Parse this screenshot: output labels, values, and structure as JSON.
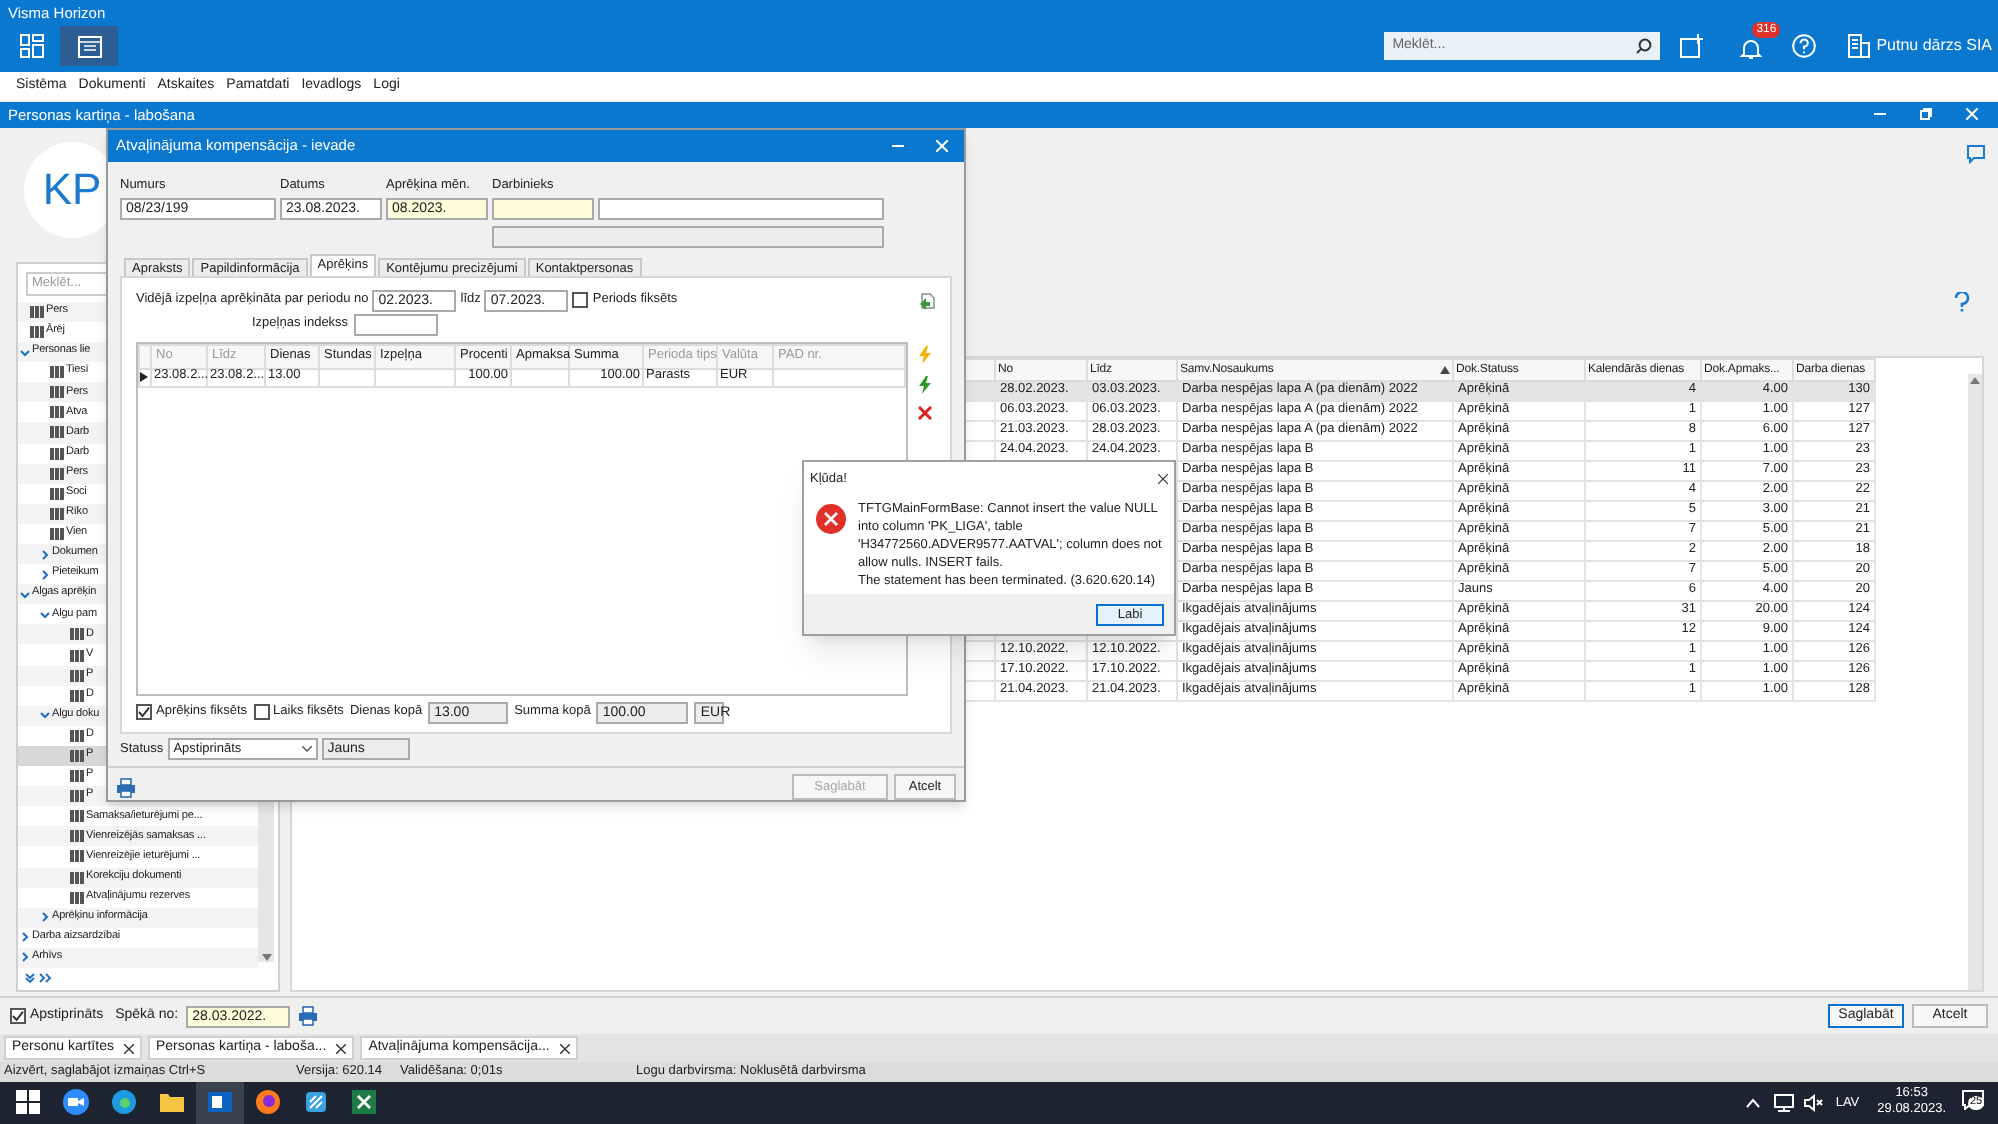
{
  "app": {
    "title": "Visma Horizon",
    "search": {
      "placeholder": "Meklēt..."
    },
    "notifications": "316",
    "company": "Putnu dārzs SIA",
    "menu": [
      "Sistēma",
      "Dokumenti",
      "Atskaites",
      "Pamatdati",
      "Ievadlogs",
      "Logi"
    ]
  },
  "window": {
    "title": "Personas kartiņa - labošana",
    "avatar": "KP",
    "sidebar": {
      "search": {
        "placeholder": "Meklēt..."
      },
      "tree": [
        {
          "label": "Pers",
          "kind": "doc",
          "selected": false
        },
        {
          "label": "Ārēj",
          "kind": "doc",
          "selected": false
        },
        {
          "label": "Personas lie",
          "kind": "folder",
          "expanded": true,
          "selected": false,
          "children": [
            {
              "label": "Tiesī",
              "kind": "doc",
              "selected": false
            },
            {
              "label": "Pers",
              "kind": "doc",
              "selected": false
            },
            {
              "label": "Atva",
              "kind": "doc",
              "selected": false
            },
            {
              "label": "Darb",
              "kind": "doc",
              "selected": false
            },
            {
              "label": "Darb",
              "kind": "doc",
              "selected": false
            },
            {
              "label": "Pers",
              "kind": "doc",
              "selected": false
            },
            {
              "label": "Soci",
              "kind": "doc",
              "selected": false
            },
            {
              "label": "Rīko",
              "kind": "doc",
              "selected": false
            },
            {
              "label": "Vien",
              "kind": "doc",
              "selected": false
            },
            {
              "label": "Dokumen",
              "kind": "folder",
              "expanded": false,
              "selected": false
            },
            {
              "label": "Pieteikum",
              "kind": "folder",
              "expanded": false,
              "selected": false
            }
          ]
        },
        {
          "label": "Algas aprēķin",
          "kind": "folder",
          "expanded": true,
          "selected": false,
          "children": [
            {
              "label": "Algu pam",
              "kind": "folder",
              "expanded": true,
              "selected": false,
              "children": [
                {
                  "label": "D",
                  "kind": "doc",
                  "selected": false
                },
                {
                  "label": "V",
                  "kind": "doc",
                  "selected": false
                },
                {
                  "label": "P",
                  "kind": "doc",
                  "selected": false
                },
                {
                  "label": "D",
                  "kind": "doc",
                  "selected": false
                }
              ]
            },
            {
              "label": "Algu doku",
              "kind": "folder",
              "expanded": true,
              "selected": false,
              "children": [
                {
                  "label": "D",
                  "kind": "doc",
                  "selected": false
                },
                {
                  "label": "P",
                  "kind": "doc",
                  "selected": true
                },
                {
                  "label": "P",
                  "kind": "doc",
                  "selected": false
                },
                {
                  "label": "P",
                  "kind": "doc",
                  "selected": false
                },
                {
                  "label": "Samaksa/ieturējumi pe...",
                  "kind": "doc",
                  "selected": false
                },
                {
                  "label": "Vienreizējās samaksas ...",
                  "kind": "doc",
                  "selected": false
                },
                {
                  "label": "Vienreizējie ieturējumi ...",
                  "kind": "doc",
                  "selected": false
                },
                {
                  "label": "Korekciju dokumenti",
                  "kind": "doc",
                  "selected": false
                },
                {
                  "label": "Atvaļinājumu rezerves",
                  "kind": "doc",
                  "selected": false
                }
              ]
            },
            {
              "label": "Aprēķinu informācija",
              "kind": "folder",
              "expanded": false,
              "selected": false
            }
          ]
        },
        {
          "label": "Darba aizsardzībai",
          "kind": "folder",
          "expanded": false,
          "selected": false
        },
        {
          "label": "Arhīvs",
          "kind": "folder",
          "expanded": false,
          "selected": false
        }
      ]
    },
    "table": {
      "columns": [
        {
          "label": "No",
          "sorted": false
        },
        {
          "label": "Līdz",
          "sorted": false
        },
        {
          "label": "Samv.Nosaukums",
          "sorted": true
        },
        {
          "label": "Dok.Statuss",
          "sorted": false
        },
        {
          "label": "Kalendārās dienas",
          "sorted": false
        },
        {
          "label": "Dok.Apmaks...",
          "sorted": false
        },
        {
          "label": "Darba dienas",
          "sorted": false
        }
      ],
      "rows": [
        {
          "selected": true,
          "cells": [
            "28.02.2023.",
            "03.03.2023.",
            "Darba nespējas lapa A (pa dienām) 2022",
            "Aprēķinā",
            "4",
            "4.00",
            "130"
          ]
        },
        {
          "selected": false,
          "cells": [
            "06.03.2023.",
            "06.03.2023.",
            "Darba nespējas lapa A (pa dienām) 2022",
            "Aprēķinā",
            "1",
            "1.00",
            "127"
          ]
        },
        {
          "selected": false,
          "cells": [
            "21.03.2023.",
            "28.03.2023.",
            "Darba nespējas lapa A (pa dienām) 2022",
            "Aprēķinā",
            "8",
            "6.00",
            "127"
          ]
        },
        {
          "selected": false,
          "cells": [
            "24.04.2023.",
            "24.04.2023.",
            "Darba nespējas lapa B",
            "Aprēķinā",
            "1",
            "1.00",
            "23"
          ]
        },
        {
          "selected": false,
          "cells": [
            null,
            null,
            "Darba nespējas lapa B",
            "Aprēķinā",
            "11",
            "7.00",
            "23"
          ]
        },
        {
          "selected": false,
          "cells": [
            null,
            null,
            "Darba nespējas lapa B",
            "Aprēķinā",
            "4",
            "2.00",
            "22"
          ]
        },
        {
          "selected": false,
          "cells": [
            null,
            null,
            "Darba nespējas lapa B",
            "Aprēķinā",
            "5",
            "3.00",
            "21"
          ]
        },
        {
          "selected": false,
          "cells": [
            null,
            null,
            "Darba nespējas lapa B",
            "Aprēķinā",
            "7",
            "5.00",
            "21"
          ]
        },
        {
          "selected": false,
          "cells": [
            null,
            null,
            "Darba nespējas lapa B",
            "Aprēķinā",
            "2",
            "2.00",
            "18"
          ]
        },
        {
          "selected": false,
          "cells": [
            null,
            null,
            "Darba nespējas lapa B",
            "Aprēķinā",
            "7",
            "5.00",
            "20"
          ]
        },
        {
          "selected": false,
          "cells": [
            null,
            null,
            "Darba nespējas lapa B",
            "Jauns",
            "6",
            "4.00",
            "20"
          ]
        },
        {
          "selected": false,
          "cells": [
            null,
            null,
            "Ikgadējais atvaļinājums",
            "Aprēķinā",
            "31",
            "20.00",
            "124"
          ]
        },
        {
          "selected": false,
          "cells": [
            null,
            null,
            "Ikgadējais atvaļinājums",
            "Aprēķinā",
            "12",
            "9.00",
            "124"
          ]
        },
        {
          "selected": false,
          "cells": [
            "12.10.2022.",
            "12.10.2022.",
            "Ikgadējais atvaļinājums",
            "Aprēķinā",
            "1",
            "1.00",
            "126"
          ]
        },
        {
          "selected": false,
          "cells": [
            "17.10.2022.",
            "17.10.2022.",
            "Ikgadējais atvaļinājums",
            "Aprēķinā",
            "1",
            "1.00",
            "126"
          ]
        },
        {
          "selected": false,
          "cells": [
            "21.04.2023.",
            "21.04.2023.",
            "Ikgadējais atvaļinājums",
            "Aprēķinā",
            "1",
            "1.00",
            "128"
          ]
        }
      ]
    },
    "footer": {
      "approved": {
        "label": "Apstiprināts",
        "checked": true
      },
      "valid_from_label": "Spēkā no:",
      "valid_from": "28.03.2022.",
      "buttons": [
        "Saglabāt",
        "Atcelt"
      ]
    }
  },
  "dialog": {
    "title": "Atvaļinājuma kompensācija - ievade",
    "fields": {
      "number_label": "Numurs",
      "number": "08/23/199",
      "date_label": "Datums",
      "date": "23.08.2023.",
      "month_label": "Aprēķina mēn.",
      "month": "08.2023.",
      "employee_label": "Darbinieks"
    },
    "tabs": [
      {
        "label": "Apraksts",
        "selected": false
      },
      {
        "label": "Papildinformācija",
        "selected": false
      },
      {
        "label": "Aprēķins",
        "selected": true
      },
      {
        "label": "Kontējumu precizējumi",
        "selected": false
      },
      {
        "label": "Kontaktpersonas",
        "selected": false
      }
    ],
    "period_label": "Vidējā izpeļņa aprēķināta par periodu no",
    "period_from": "02.2023.",
    "period_to_label": "līdz",
    "period_to": "07.2023.",
    "period_fixed": {
      "label": "Periods fiksēts",
      "checked": false
    },
    "index_label": "Izpeļņas indekss",
    "grid": {
      "columns": [
        {
          "label": "No",
          "disabled": true
        },
        {
          "label": "Līdz",
          "disabled": true
        },
        {
          "label": "Dienas",
          "disabled": false
        },
        {
          "label": "Stundas",
          "disabled": false
        },
        {
          "label": "Izpeļņa",
          "disabled": false
        },
        {
          "label": "Procenti",
          "disabled": false
        },
        {
          "label": "Apmaksa",
          "disabled": false
        },
        {
          "label": "Summa",
          "disabled": false
        },
        {
          "label": "Perioda tips",
          "disabled": true
        },
        {
          "label": "Valūta",
          "disabled": true
        },
        {
          "label": "PAD nr.",
          "disabled": true
        }
      ],
      "rows": [
        {
          "cells": [
            "23.08.2...",
            "23.08.2...",
            "13.00",
            null,
            null,
            "100.00",
            null,
            "100.00",
            "Parasts",
            "EUR",
            null
          ]
        }
      ]
    },
    "calc_fixed": {
      "label": "Aprēķins fiksēts",
      "checked": true
    },
    "time_fixed": {
      "label": "Laiks fiksēts",
      "checked": false
    },
    "days_total_label": "Dienas kopā",
    "days_total": "13.00",
    "sum_total_label": "Summa kopā",
    "sum_total": "100.00",
    "currency": "EUR",
    "status_label": "Statuss",
    "status": "Apstiprināts",
    "state": "Jauns",
    "buttons": [
      {
        "label": "Saglabāt",
        "disabled": true
      },
      {
        "label": "Atcelt",
        "disabled": false
      }
    ]
  },
  "error": {
    "title": "Kļūda!",
    "message": [
      "TFTGMainFormBase: Cannot insert the value NULL into column 'PK_LIGA', table 'H34772560.ADVER9577.AATVAL'; column does not allow nulls. INSERT fails.",
      "The statement has been terminated. (3.620.620.14)"
    ],
    "button": "Labi"
  },
  "doc_tabs": [
    "Personu kartītes",
    "Personas kartiņa - laboša...",
    "Atvaļinājuma kompensācija..."
  ],
  "status_bar": [
    "Aizvērt, saglabājot izmaiņas Ctrl+S",
    "Versija: 620.14",
    "Validēšana: 0;01s",
    "Logu darbvirsma: Noklusētā darbvirsma"
  ],
  "taskbar": {
    "language": "LAV",
    "time": "16:53",
    "date": "29.08.2023.",
    "notifications": "25"
  }
}
